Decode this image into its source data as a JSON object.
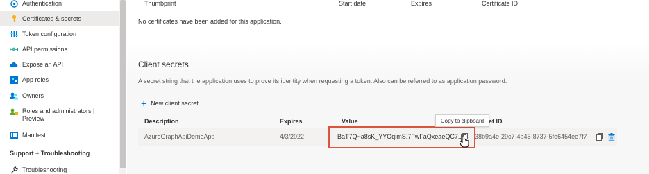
{
  "sidebar": {
    "items": [
      {
        "label": "Authentication",
        "icon": "authentication-icon"
      },
      {
        "label": "Certificates & secrets",
        "icon": "key-icon",
        "active": true
      },
      {
        "label": "Token configuration",
        "icon": "token-config-icon"
      },
      {
        "label": "API permissions",
        "icon": "api-permissions-icon"
      },
      {
        "label": "Expose an API",
        "icon": "cloud-icon"
      },
      {
        "label": "App roles",
        "icon": "app-roles-icon"
      },
      {
        "label": "Owners",
        "icon": "owners-icon"
      },
      {
        "label": "Roles and administrators |",
        "label2": "Preview",
        "icon": "roles-admin-icon"
      },
      {
        "label": "Manifest",
        "icon": "manifest-icon"
      }
    ],
    "section_label": "Support + Troubleshooting",
    "support_items": [
      {
        "label": "Troubleshooting",
        "icon": "wrench-icon"
      }
    ]
  },
  "certificates": {
    "headers": [
      "Thumbprint",
      "Start date",
      "Expires",
      "Certificate ID"
    ],
    "empty_message": "No certificates have been added for this application."
  },
  "client_secrets": {
    "title": "Client secrets",
    "description": "A secret string that the application uses to prove its identity when requesting a token. Also can be referred to as application password.",
    "new_button": "New client secret",
    "headers": [
      "Description",
      "Expires",
      "Value",
      "et ID"
    ],
    "rows": [
      {
        "description": "AzureGraphApiDemoApp",
        "expires": "4/3/2022",
        "value": "BaT7Q~a8sK_YYOqimS.7FwFaQxeaeQC7...",
        "secret_id": "38b9a4e-29c7-4b45-8737-5fe6454ee7f7"
      }
    ],
    "tooltip": "Copy to clipboard"
  },
  "colors": {
    "accent": "#0078d4",
    "highlight": "#e0533b",
    "active_bg": "#edebe9"
  }
}
